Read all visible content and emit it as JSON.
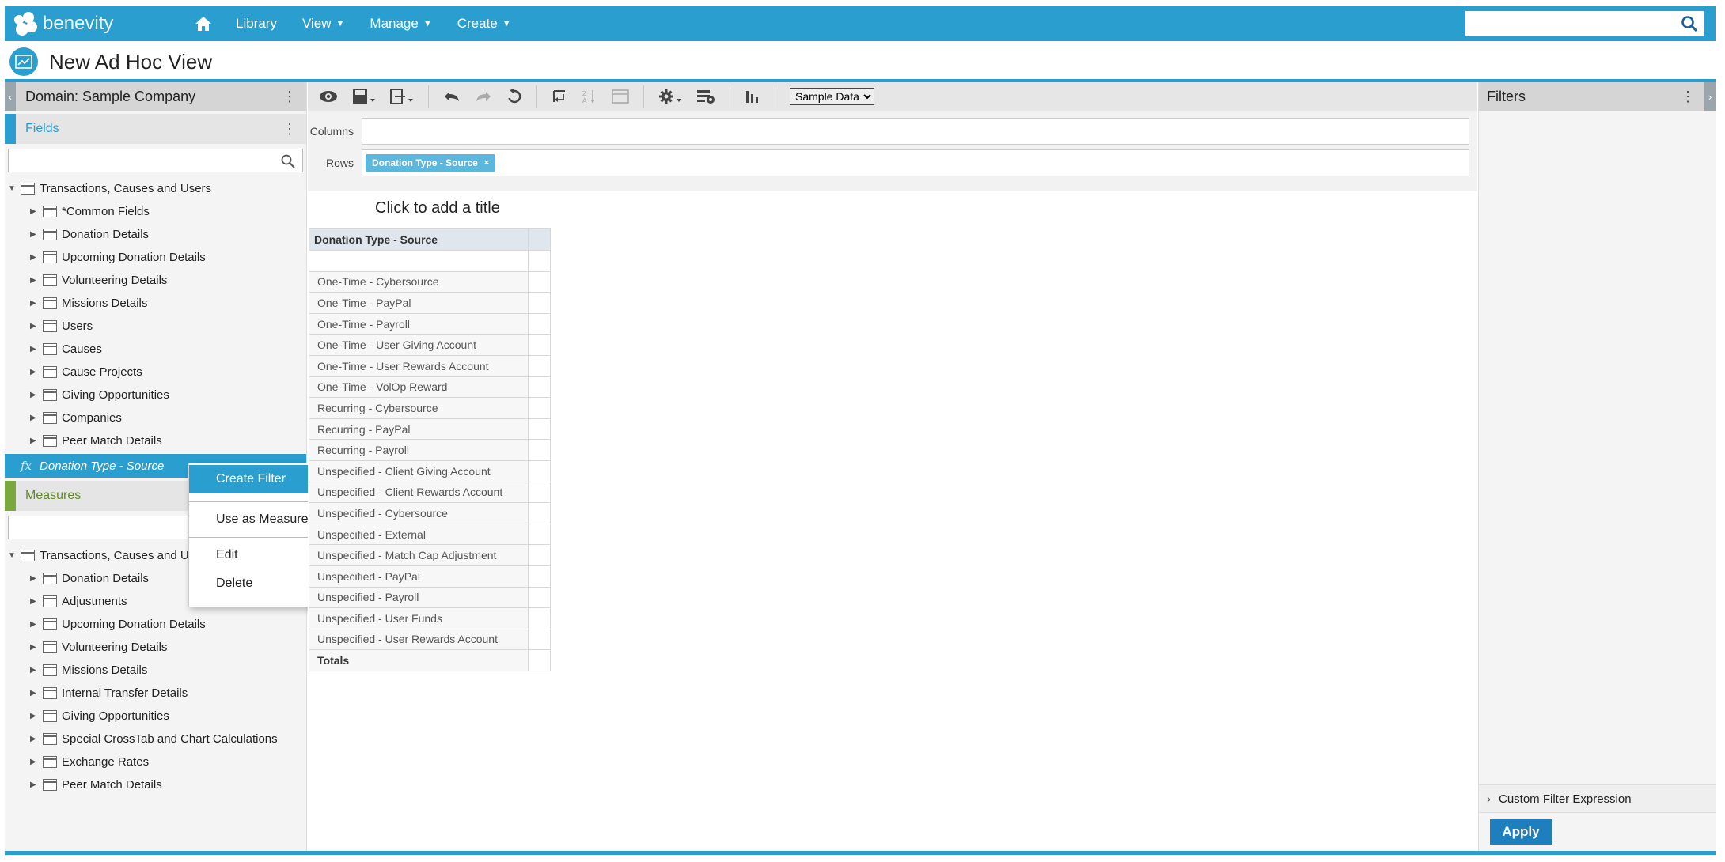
{
  "nav": {
    "logo_text": "benevity",
    "items": [
      {
        "label": "Library",
        "caret": false
      },
      {
        "label": "View",
        "caret": true
      },
      {
        "label": "Manage",
        "caret": true
      },
      {
        "label": "Create",
        "caret": true
      }
    ],
    "search_value": ""
  },
  "page": {
    "title": "New Ad Hoc View"
  },
  "left": {
    "domain_label": "Domain: Sample Company",
    "fields_label": "Fields",
    "fields_search": "",
    "fields_tree": [
      {
        "label": "Transactions, Causes and Users",
        "level": 0,
        "expanded": true
      },
      {
        "label": "*Common Fields",
        "level": 1
      },
      {
        "label": "Donation Details",
        "level": 1
      },
      {
        "label": "Upcoming Donation Details",
        "level": 1
      },
      {
        "label": "Volunteering Details",
        "level": 1
      },
      {
        "label": "Missions Details",
        "level": 1
      },
      {
        "label": "Users",
        "level": 1
      },
      {
        "label": "Causes",
        "level": 1
      },
      {
        "label": "Cause Projects",
        "level": 1
      },
      {
        "label": "Giving Opportunities",
        "level": 1
      },
      {
        "label": "Companies",
        "level": 1
      },
      {
        "label": "Peer Match Details",
        "level": 1
      }
    ],
    "calculated_field": {
      "fx": "fx",
      "label": "Donation Type - Source"
    },
    "measures_label": "Measures",
    "measures_search": "",
    "measures_tree": [
      {
        "label": "Transactions, Causes and Users",
        "level": 0,
        "expanded": true
      },
      {
        "label": "Donation Details",
        "level": 1
      },
      {
        "label": "Adjustments",
        "level": 1
      },
      {
        "label": "Upcoming Donation Details",
        "level": 1
      },
      {
        "label": "Volunteering Details",
        "level": 1
      },
      {
        "label": "Missions Details",
        "level": 1
      },
      {
        "label": "Internal Transfer Details",
        "level": 1
      },
      {
        "label": "Giving Opportunities",
        "level": 1
      },
      {
        "label": "Special CrossTab and Chart Calculations",
        "level": 1
      },
      {
        "label": "Exchange Rates",
        "level": 1
      },
      {
        "label": "Peer Match Details",
        "level": 1
      }
    ]
  },
  "context_menu": {
    "items": [
      "Create Filter",
      "Use as Measure",
      "Edit",
      "Delete"
    ]
  },
  "toolbar": {
    "data_select": "Sample Data",
    "data_options": [
      "Sample Data"
    ]
  },
  "dropzones": {
    "columns_label": "Columns",
    "rows_label": "Rows",
    "rows_pill": "Donation Type - Source",
    "pill_remove": "×"
  },
  "canvas": {
    "title_placeholder": "Click to add a title",
    "header": "Donation Type - Source",
    "rows": [
      "One-Time - Cybersource",
      "One-Time - PayPal",
      "One-Time - Payroll",
      "One-Time - User Giving Account",
      "One-Time - User Rewards Account",
      "One-Time - VolOp Reward",
      "Recurring - Cybersource",
      "Recurring - PayPal",
      "Recurring - Payroll",
      "Unspecified - Client Giving Account",
      "Unspecified - Client Rewards Account",
      "Unspecified - Cybersource",
      "Unspecified - External",
      "Unspecified - Match Cap Adjustment",
      "Unspecified - PayPal",
      "Unspecified - Payroll",
      "Unspecified - User Funds",
      "Unspecified - User Rewards Account"
    ],
    "totals_label": "Totals"
  },
  "filters": {
    "label": "Filters",
    "custom_expression": "Custom Filter Expression",
    "apply_label": "Apply"
  },
  "colors": {
    "brand": "#2a9fcf",
    "measures_accent": "#7aa83c",
    "apply": "#1e7fbe"
  }
}
